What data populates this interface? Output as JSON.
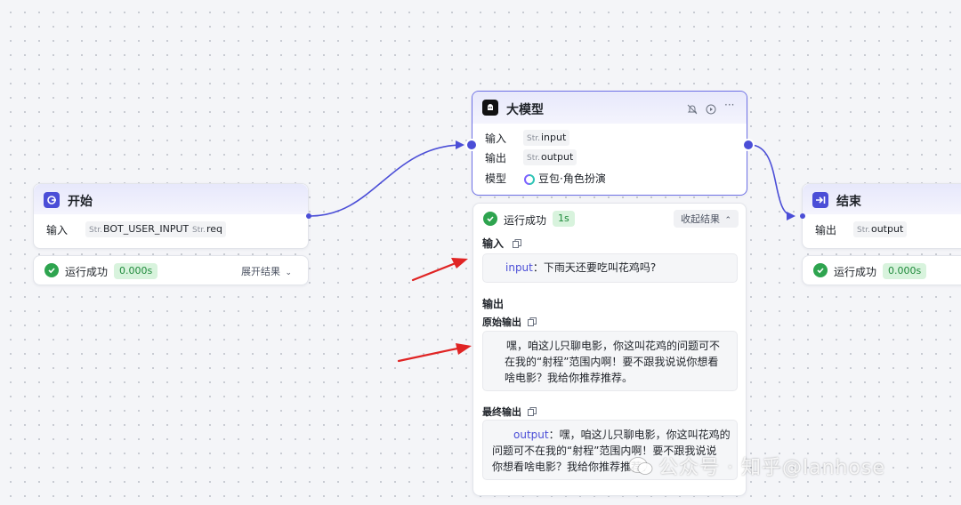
{
  "start_node": {
    "title": "开始",
    "input_label": "输入",
    "inputs": [
      {
        "type": "Str.",
        "name": "BOT_USER_INPUT"
      },
      {
        "type": "Str.",
        "name": "req"
      }
    ],
    "status": "运行成功",
    "time": "0.000s",
    "toggle": "展开结果"
  },
  "llm_node": {
    "title": "大模型",
    "input_label": "输入",
    "input_var": {
      "type": "Str.",
      "name": "input"
    },
    "output_label": "输出",
    "output_var": {
      "type": "Str.",
      "name": "output"
    },
    "model_label": "模型",
    "model_name": "豆包·角色扮演",
    "status": "运行成功",
    "time": "1s",
    "toggle": "收起结果",
    "result_input_label": "输入",
    "result_input_key": "input",
    "result_input_value": "下雨天还要吃叫花鸡吗?",
    "result_output_label": "输出",
    "raw_output_label": "原始输出",
    "raw_output_lines": [
      "嘿，咱这儿只聊电影，你这叫花鸡的问题可不",
      "在我的“射程”范围内啊！要不跟我说说你想看",
      "啥电影？我给你推荐推荐。"
    ],
    "final_output_label": "最终输出",
    "final_output_key": "output",
    "final_output_lines": [
      "嘿，咱这儿只聊电影，你这叫花鸡的",
      "问题可不在我的“射程”范围内啊！要不跟我说说",
      "你想看啥电影？我给你推荐推荐。"
    ]
  },
  "end_node": {
    "title": "结束",
    "output_label": "输出",
    "output_var": {
      "type": "Str.",
      "name": "output"
    },
    "status": "运行成功",
    "time": "0.000s"
  },
  "watermark": "公众号 · 知乎@lanhose",
  "colors": {
    "accent": "#4b4ed7",
    "success": "#2ea44f",
    "arrow": "#e02424"
  }
}
